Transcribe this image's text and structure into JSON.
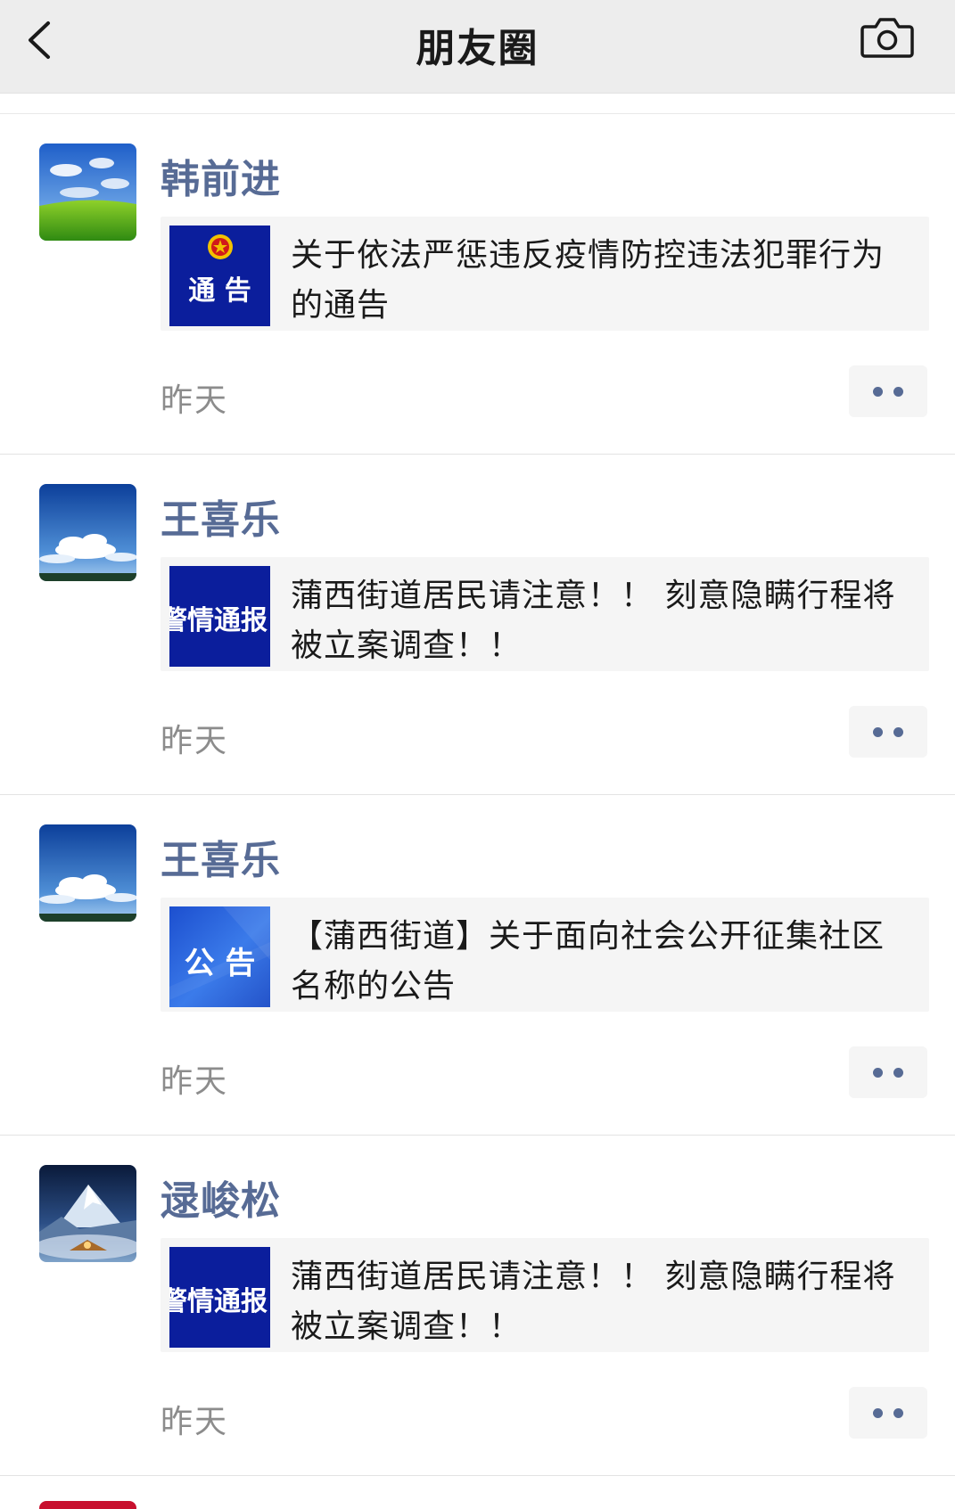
{
  "header": {
    "title": "朋友圈",
    "back_icon": "chevron-left-icon",
    "camera_icon": "camera-icon",
    "background": "#ededed"
  },
  "colors": {
    "name": "#576b95",
    "time": "#8c8c8c",
    "card_bg": "#f5f5f5",
    "thumb_navy": "#0b1e9c",
    "thumb_blue": "#2a5fd6"
  },
  "posts": [
    {
      "name": "韩前进",
      "avatar": "meadow-sky",
      "thumb_type": "police-notice",
      "thumb_label": "通 告",
      "text": "关于依法严惩违反疫情防控违法犯罪行为的通告",
      "time": "昨天"
    },
    {
      "name": "王喜乐",
      "avatar": "blue-sky-clouds",
      "thumb_type": "alert-report",
      "thumb_label": "警情通报",
      "text": "蒲西街道居民请注意！！ 刻意隐瞒行程将被立案调查！！",
      "time": "昨天"
    },
    {
      "name": "王喜乐",
      "avatar": "blue-sky-clouds",
      "thumb_type": "announcement",
      "thumb_label": "公 告",
      "text": "【蒲西街道】关于面向社会公开征集社区名称的公告",
      "time": "昨天"
    },
    {
      "name": "逯峻松",
      "avatar": "mountain-night",
      "thumb_type": "alert-report",
      "thumb_label": "警情通报",
      "text": "蒲西街道居民请注意！！ 刻意隐瞒行程将被立案调查！！",
      "time": "昨天"
    }
  ]
}
